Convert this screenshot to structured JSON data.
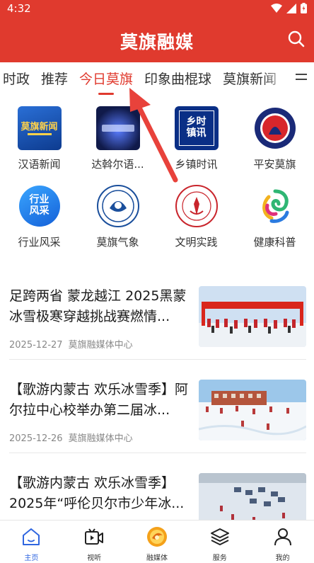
{
  "status_bar": {
    "time": "4:32"
  },
  "app": {
    "title": "莫旗融媒"
  },
  "tabs": [
    {
      "label": "时政"
    },
    {
      "label": "推荐"
    },
    {
      "label": "今日莫旗",
      "active": true
    },
    {
      "label": "印象曲棍球"
    },
    {
      "label": "莫旗新闻"
    }
  ],
  "shortcuts": [
    {
      "label": "汉语新闻",
      "icon": "hanyu-news-icon",
      "badge": "莫旗新闻"
    },
    {
      "label": "达斡尔语...",
      "icon": "daur-language-icon"
    },
    {
      "label": "乡镇时讯",
      "icon": "town-news-icon",
      "badge": "乡时镇讯"
    },
    {
      "label": "平安莫旗",
      "icon": "pingan-moqi-icon"
    },
    {
      "label": "行业风采",
      "icon": "industry-style-icon",
      "badge": "行业风采"
    },
    {
      "label": "莫旗气象",
      "icon": "weather-icon"
    },
    {
      "label": "文明实践",
      "icon": "civilization-practice-icon"
    },
    {
      "label": "健康科普",
      "icon": "health-science-icon"
    }
  ],
  "news": [
    {
      "headline": "足跨两省 蒙龙越江 2025黑蒙冰雪极寒穿越挑战赛燃情...",
      "date": "2025-12-27",
      "source": "莫旗融媒体中心"
    },
    {
      "headline": "【歌游内蒙古 欢乐冰雪季】阿尔拉中心校举办第二届冰...",
      "date": "2025-12-26",
      "source": "莫旗融媒体中心"
    },
    {
      "headline": "【歌游内蒙古 欢乐冰雪季】2025年“呼伦贝尔市少年冰...",
      "date": "",
      "source": ""
    }
  ],
  "bottom_nav": [
    {
      "label": "主页",
      "icon": "home-icon",
      "active": true
    },
    {
      "label": "视听",
      "icon": "video-icon"
    },
    {
      "label": "融媒体",
      "icon": "media-logo-icon"
    },
    {
      "label": "服务",
      "icon": "layers-icon"
    },
    {
      "label": "我的",
      "icon": "profile-icon"
    }
  ],
  "colors": {
    "brand_red": "#e03a2e",
    "active_blue": "#2f66e0",
    "arrow_red": "#e8423b"
  }
}
